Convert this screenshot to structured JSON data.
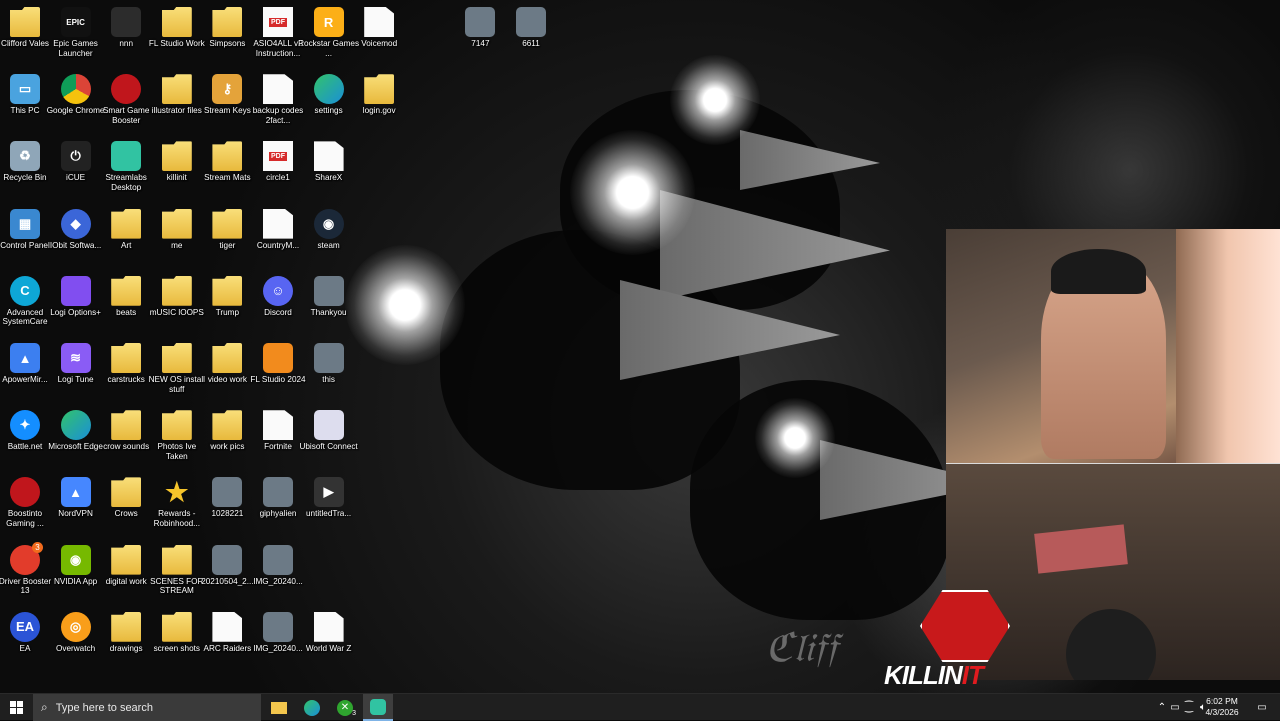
{
  "desktop": {
    "icons": [
      {
        "label": "Clifford Vales",
        "icon": "user-folder-icon"
      },
      {
        "label": "Epic Games Launcher",
        "icon": "epic-games-icon"
      },
      {
        "label": "nnn",
        "icon": "app-window-icon"
      },
      {
        "label": "FL Studio Work",
        "icon": "folder-icon"
      },
      {
        "label": "Simpsons",
        "icon": "folder-icon"
      },
      {
        "label": "ASIO4ALL v2 Instruction...",
        "icon": "pdf-icon"
      },
      {
        "label": "Rockstar Games ...",
        "icon": "rockstar-icon"
      },
      {
        "label": "Voicemod",
        "icon": "document-icon"
      },
      {
        "label": "7147",
        "icon": "image-thumbnail-icon"
      },
      {
        "label": "6611",
        "icon": "image-thumbnail-icon"
      },
      {
        "label": "This PC",
        "icon": "computer-icon"
      },
      {
        "label": "Google Chrome",
        "icon": "chrome-icon"
      },
      {
        "label": "Smart Game Booster",
        "icon": "game-booster-icon"
      },
      {
        "label": "illustrator files",
        "icon": "folder-icon"
      },
      {
        "label": "Stream Keys",
        "icon": "key-icon"
      },
      {
        "label": "backup codes 2fact...",
        "icon": "document-icon"
      },
      {
        "label": "settings",
        "icon": "edge-icon"
      },
      {
        "label": "login.gov",
        "icon": "folder-icon"
      },
      {
        "label": "Recycle Bin",
        "icon": "recycle-bin-icon"
      },
      {
        "label": "iCUE",
        "icon": "icue-icon"
      },
      {
        "label": "Streamlabs Desktop",
        "icon": "streamlabs-icon"
      },
      {
        "label": "killinit",
        "icon": "folder-icon"
      },
      {
        "label": "Stream Mats",
        "icon": "folder-icon"
      },
      {
        "label": "circle1",
        "icon": "pdf-icon"
      },
      {
        "label": "ShareX",
        "icon": "document-icon"
      },
      {
        "label": "Control Panel",
        "icon": "control-panel-icon"
      },
      {
        "label": "IObit Softwa...",
        "icon": "iobit-icon"
      },
      {
        "label": "Art",
        "icon": "folder-icon"
      },
      {
        "label": "me",
        "icon": "folder-icon"
      },
      {
        "label": "tiger",
        "icon": "folder-icon"
      },
      {
        "label": "CountryM...",
        "icon": "document-icon"
      },
      {
        "label": "steam",
        "icon": "steam-icon"
      },
      {
        "label": "Advanced SystemCare",
        "icon": "systemcare-icon"
      },
      {
        "label": "Logi Options+",
        "icon": "logi-options-icon"
      },
      {
        "label": "beats",
        "icon": "folder-icon"
      },
      {
        "label": "mUSIC lOOPS",
        "icon": "folder-icon"
      },
      {
        "label": "Trump",
        "icon": "folder-icon"
      },
      {
        "label": "Discord",
        "icon": "discord-icon"
      },
      {
        "label": "Thankyou",
        "icon": "image-thumbnail-icon"
      },
      {
        "label": "ApowerMir...",
        "icon": "apowermirror-icon"
      },
      {
        "label": "Logi Tune",
        "icon": "logi-tune-icon"
      },
      {
        "label": "carstrucks",
        "icon": "folder-icon"
      },
      {
        "label": "NEW OS install stuff",
        "icon": "folder-icon"
      },
      {
        "label": "video work",
        "icon": "folder-icon"
      },
      {
        "label": "FL Studio 2024",
        "icon": "fl-studio-icon"
      },
      {
        "label": "this",
        "icon": "image-thumbnail-icon"
      },
      {
        "label": "Battle.net",
        "icon": "battlenet-icon"
      },
      {
        "label": "Microsoft Edge",
        "icon": "edge-icon"
      },
      {
        "label": "crow sounds",
        "icon": "folder-icon"
      },
      {
        "label": "Photos Ive Taken",
        "icon": "folder-icon"
      },
      {
        "label": "work pics",
        "icon": "folder-icon"
      },
      {
        "label": "Fortnite",
        "icon": "document-icon"
      },
      {
        "label": "Ubisoft Connect",
        "icon": "ubisoft-icon"
      },
      {
        "label": "Boostinto Gaming ...",
        "icon": "game-booster-icon"
      },
      {
        "label": "NordVPN",
        "icon": "nordvpn-icon"
      },
      {
        "label": "Crows",
        "icon": "folder-icon"
      },
      {
        "label": "Rewards - Robinhood...",
        "icon": "star-icon"
      },
      {
        "label": "1028221",
        "icon": "image-thumbnail-icon"
      },
      {
        "label": "giphyalien",
        "icon": "image-thumbnail-icon"
      },
      {
        "label": "untitledTra...",
        "icon": "video-icon"
      },
      {
        "label": "Driver Booster 13",
        "icon": "driver-booster-icon"
      },
      {
        "label": "NVIDIA App",
        "icon": "nvidia-icon"
      },
      {
        "label": "digital work",
        "icon": "folder-icon"
      },
      {
        "label": "SCENES FOR STREAM",
        "icon": "folder-icon"
      },
      {
        "label": "20210504_2...",
        "icon": "image-thumbnail-icon"
      },
      {
        "label": "IMG_20240...",
        "icon": "image-thumbnail-icon"
      },
      {
        "label": "EA",
        "icon": "ea-icon"
      },
      {
        "label": "Overwatch",
        "icon": "overwatch-icon"
      },
      {
        "label": "drawings",
        "icon": "folder-icon"
      },
      {
        "label": "screen shots",
        "icon": "folder-icon"
      },
      {
        "label": "ARC Raiders",
        "icon": "document-icon"
      },
      {
        "label": "IMG_20240...",
        "icon": "image-thumbnail-icon"
      },
      {
        "label": "World War Z",
        "icon": "document-icon"
      }
    ]
  },
  "overlay": {
    "logo_text_white": "KILLIN",
    "logo_text_red": "IT"
  },
  "taskbar": {
    "search_placeholder": "Type here to search",
    "xbox_badge": "3",
    "driver_booster_badge": "3",
    "clock_time": "6:02 PM",
    "clock_date": "4/3/2026"
  }
}
